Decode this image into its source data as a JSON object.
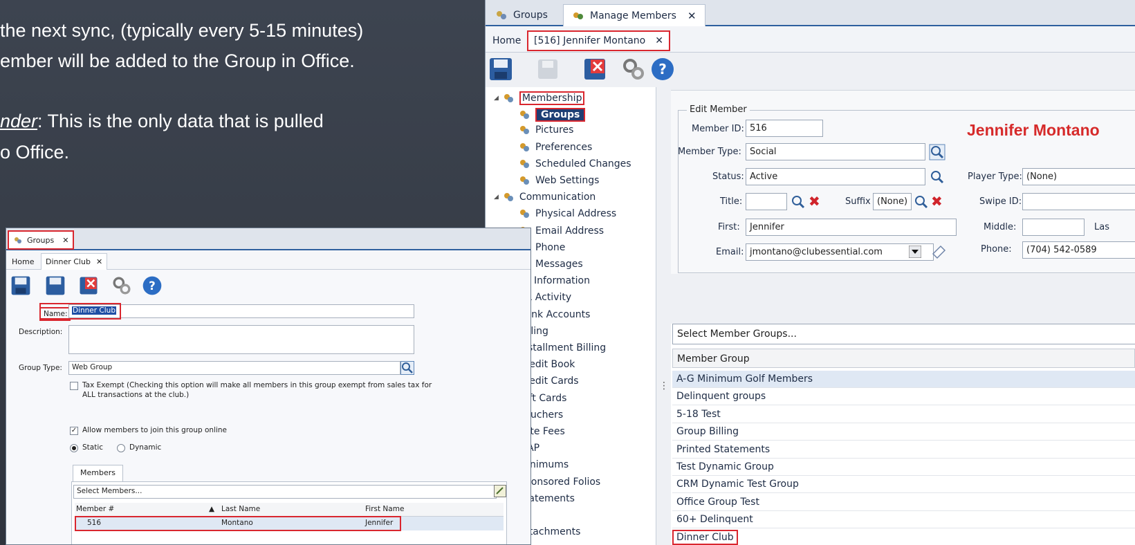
{
  "slide": {
    "line1": "the next sync, (typically every 5-15 minutes)",
    "line2": "ember will be added to the Group in Office.",
    "line3_italic": "nder",
    "line3_rest": ": This is the only data that is pulled",
    "line4": "o Office."
  },
  "main_window": {
    "outer_tabs": [
      "Groups",
      "Manage Members"
    ],
    "inner_tabs": [
      "Home",
      "[516] Jennifer Montano"
    ],
    "close_glyph": "✕",
    "sidebar": {
      "items": [
        "Membership",
        "Groups",
        "Pictures",
        "Preferences",
        "Scheduled Changes",
        "Web Settings",
        "Communication",
        "Physical Address",
        "Email Address",
        "Phone",
        "Messages",
        "ancial Information",
        "AR Activity",
        "Bank Accounts",
        "Billing",
        "Installment Billing",
        "Credit Book",
        "Credit Cards",
        "Gift Cards",
        "Vouchers",
        "Late Fees",
        "MAP",
        "Minimums",
        "Sponsored Folios",
        "Statements",
        "her",
        "Attachments"
      ]
    },
    "edit_member": {
      "legend": "Edit Member",
      "member_id_label": "Member ID:",
      "member_id": "516",
      "member_type_label": "Member Type:",
      "member_type": "Social",
      "status_label": "Status:",
      "status": "Active",
      "title_label": "Title:",
      "title": "",
      "suffix_label": "Suffix",
      "suffix": "(None)",
      "first_label": "First:",
      "first": "Jennifer",
      "email_label": "Email:",
      "email": "jmontano@clubessential.com",
      "player_type_label": "Player Type:",
      "player_type": "(None)",
      "swipe_id_label": "Swipe ID:",
      "swipe_id": "",
      "middle_label": "Middle:",
      "middle": "",
      "last_label": "Las",
      "phone_label": "Phone:",
      "phone": "(704) 542-0589",
      "display_name": "Jennifer Montano"
    },
    "groups": {
      "placeholder": "Select Member Groups...",
      "column": "Member Group",
      "rows": [
        "A-G Minimum Golf Members",
        "Delinquent groups",
        "5-18 Test",
        "Group Billing",
        "Printed Statements",
        "Test Dynamic Group",
        "CRM Dynamic Test Group",
        "Office Group Test",
        "60+ Delinquent",
        "Dinner Club"
      ]
    }
  },
  "small_window": {
    "tab": "Groups",
    "inner_tabs": [
      "Home",
      "Dinner Club"
    ],
    "name_label": "Name:",
    "name": "Dinner Club",
    "description_label": "Description:",
    "description": "",
    "group_type_label": "Group Type:",
    "group_type": "Web Group",
    "tax_exempt_line1": "Tax Exempt (Checking this option will make all members in this group exempt from sales tax for",
    "tax_exempt_line2": "ALL transactions at the club.)",
    "allow_online": "Allow members to join this group online",
    "allow_online_checked": true,
    "radio_static": "Static",
    "radio_dynamic": "Dynamic",
    "selected_radio": "Static",
    "members_tab": "Members",
    "select_members": "Select Members...",
    "columns": [
      "Member #",
      "Last Name",
      "First Name"
    ],
    "rows": [
      {
        "member_no": "516",
        "last": "Montano",
        "first": "Jennifer"
      }
    ]
  },
  "colors": {
    "highlight": "#d9262e",
    "accent_blue": "#2e5f9e",
    "name_red": "#d62a2a",
    "selected_row": "#dfe8f4"
  }
}
